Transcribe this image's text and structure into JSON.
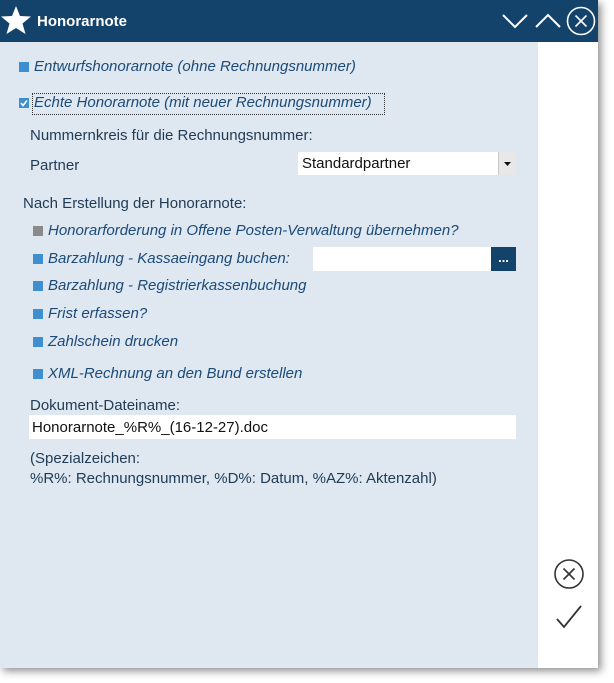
{
  "window": {
    "title": "Honorarnote"
  },
  "options": {
    "draft_label": "Entwurfshonorarnote (ohne Rechnungsnummer)",
    "real_label": "Echte Honorarnote (mit neuer Rechnungsnummer)"
  },
  "numbering": {
    "heading": "Nummernkreis für die Rechnungsnummer:",
    "partner_label": "Partner",
    "partner_value": "Standardpartner"
  },
  "after_creation": {
    "heading": "Nach Erstellung der Honorarnote:",
    "items": [
      {
        "label": "Honorarforderung in Offene Posten-Verwaltung übernehmen?",
        "enabled": false
      },
      {
        "label": "Barzahlung - Kassaeingang buchen:",
        "enabled": true
      },
      {
        "label": "Barzahlung - Registrierkassenbuchung",
        "enabled": true
      },
      {
        "label": "Frist erfassen?",
        "enabled": true
      },
      {
        "label": "Zahlschein drucken",
        "enabled": true
      },
      {
        "label": "XML-Rechnung an den Bund erstellen",
        "enabled": true
      }
    ],
    "cash_entry_value": "",
    "browse_label": "..."
  },
  "document": {
    "label": "Dokument-Dateiname:",
    "filename": "Honorarnote_%R%_(16-12-27).doc",
    "hint_line1": "(Spezialzeichen:",
    "hint_line2": "%R%: Rechnungsnummer, %D%: Datum, %AZ%: Aktenzahl)"
  },
  "colors": {
    "titlebar": "#13426b",
    "panel": "#dfe8f0",
    "accent": "#3d8fd0",
    "disabled": "#8a8a8a"
  },
  "icons": {
    "title": "star-icon",
    "collapse": "chevron-down-icon",
    "expand": "chevron-up-icon",
    "close": "close-circle-icon",
    "cancel": "cancel-circle-icon",
    "confirm": "checkmark-icon"
  }
}
